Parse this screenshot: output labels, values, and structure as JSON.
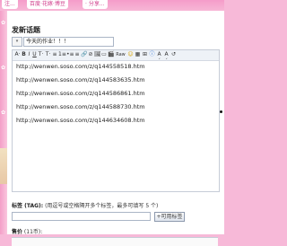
{
  "header": {
    "tabs": [
      "注...",
      "百度·花嫁·博豆",
      "· 分享..."
    ]
  },
  "post": {
    "heading": "发新话题",
    "type_select": "▾",
    "subject": "今天的作业！！！"
  },
  "toolbar": {
    "items": [
      "A·",
      "B",
      "I",
      "U",
      "T·",
      "T·",
      "≡",
      "1≡",
      "•≡",
      "≡",
      "🔗",
      "⊘",
      "🖼",
      "▭",
      "🎬",
      "Raw",
      "☺",
      "▦",
      "⊞",
      "ⓘ",
      "A´",
      "A´",
      "↺"
    ]
  },
  "editor": {
    "links": [
      "http://wenwen.soso.com/z/q144558518.htm",
      "http://wenwen.soso.com/z/q144583635.htm",
      "http://wenwen.soso.com/z/q144586861.htm",
      "http://wenwen.soso.com/z/q144588730.htm",
      "http://wenwen.soso.com/z/q144634608.htm"
    ]
  },
  "tags": {
    "label_bold": "标签 (TAG):",
    "label_rest": " (用逗号或空格隔开多个标签，最多可填写 5 个)",
    "button": "+可用标签"
  },
  "reward": {
    "label_bold": "售价",
    "label_rest": " (11币):"
  }
}
